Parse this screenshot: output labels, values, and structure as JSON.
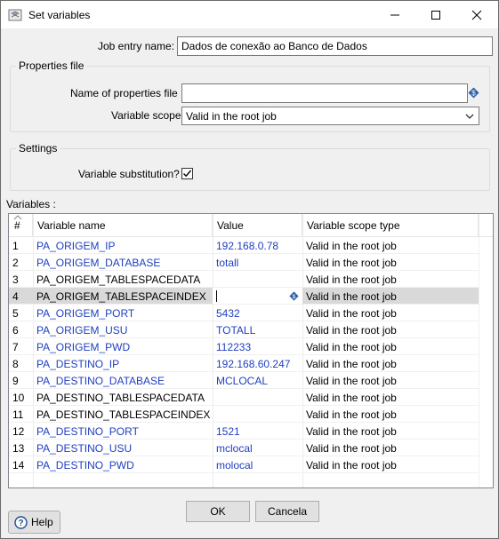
{
  "window": {
    "title": "Set variables"
  },
  "form": {
    "job_entry_label": "Job entry name:",
    "job_entry_value": "Dados de conexão ao Banco de Dados",
    "properties_group": "Properties file",
    "properties_file_label": "Name of properties file",
    "properties_file_value": "",
    "variable_scope_label": "Variable scope",
    "variable_scope_value": "Valid in the root job",
    "settings_group": "Settings",
    "variable_substitution_label": "Variable substitution?",
    "variable_substitution_checked": true,
    "variables_label": "Variables :"
  },
  "table": {
    "headers": [
      "#",
      "Variable name",
      "Value",
      "Variable scope type"
    ],
    "rows": [
      {
        "num": "1",
        "name": "PA_ORIGEM_IP",
        "value": "192.168.0.78",
        "scope": "Valid in the root job",
        "blue": true
      },
      {
        "num": "2",
        "name": "PA_ORIGEM_DATABASE",
        "value": "totall",
        "scope": "Valid in the root job",
        "blue": true
      },
      {
        "num": "3",
        "name": "PA_ORIGEM_TABLESPACEDATA",
        "value": "",
        "scope": "Valid in the root job",
        "blue": false
      },
      {
        "num": "4",
        "name": "PA_ORIGEM_TABLESPACEINDEX",
        "value": "",
        "scope": "Valid in the root job",
        "blue": false
      },
      {
        "num": "5",
        "name": "PA_ORIGEM_PORT",
        "value": "5432",
        "scope": "Valid in the root job",
        "blue": true
      },
      {
        "num": "6",
        "name": "PA_ORIGEM_USU",
        "value": "TOTALL",
        "scope": "Valid in the root job",
        "blue": true
      },
      {
        "num": "7",
        "name": "PA_ORIGEM_PWD",
        "value": "112233",
        "scope": "Valid in the root job",
        "blue": true
      },
      {
        "num": "8",
        "name": "PA_DESTINO_IP",
        "value": "192.168.60.247",
        "scope": "Valid in the root job",
        "blue": true
      },
      {
        "num": "9",
        "name": "PA_DESTINO_DATABASE",
        "value": "MCLOCAL",
        "scope": "Valid in the root job",
        "blue": true
      },
      {
        "num": "10",
        "name": "PA_DESTINO_TABLESPACEDATA",
        "value": "",
        "scope": "Valid in the root job",
        "blue": false
      },
      {
        "num": "11",
        "name": "PA_DESTINO_TABLESPACEINDEX",
        "value": "",
        "scope": "Valid in the root job",
        "blue": false
      },
      {
        "num": "12",
        "name": "PA_DESTINO_PORT",
        "value": "1521",
        "scope": "Valid in the root job",
        "blue": true
      },
      {
        "num": "13",
        "name": "PA_DESTINO_USU",
        "value": "mclocal",
        "scope": "Valid in the root job",
        "blue": true
      },
      {
        "num": "14",
        "name": "PA_DESTINO_PWD",
        "value": "molocal",
        "scope": "Valid in the root job",
        "blue": true
      }
    ],
    "selected_row": "4"
  },
  "buttons": {
    "ok": "OK",
    "cancel": "Cancela",
    "help": "Help"
  },
  "colors": {
    "blue_text": "#1f3fbf",
    "selected_row": "#d9d9d9",
    "variable_icon": "#2b5fa8"
  },
  "icons": [
    "app-icon",
    "variable-icon",
    "help-icon",
    "chevron-down-icon",
    "checkmark-icon"
  ]
}
